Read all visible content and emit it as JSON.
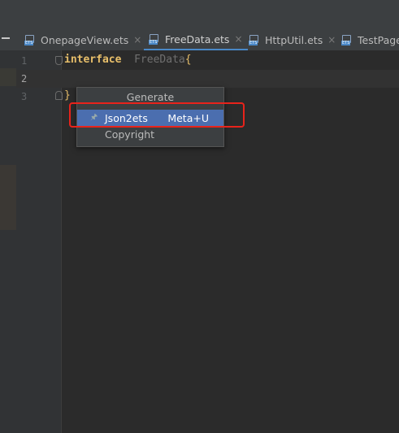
{
  "tabs": [
    {
      "label": "OnepageView.ets",
      "active": false,
      "close": "×",
      "icon": "ets-file-icon"
    },
    {
      "label": "FreeData.ets",
      "active": true,
      "close": "×",
      "icon": "ets-file-icon"
    },
    {
      "label": "HttpUtil.ets",
      "active": false,
      "close": "×",
      "icon": "ets-file-icon"
    },
    {
      "label": "TestPage",
      "active": false,
      "close": "",
      "icon": "ets-file-icon"
    }
  ],
  "gutter": {
    "lines": [
      "1",
      "2",
      "3"
    ]
  },
  "code": {
    "line1_keyword": "interface",
    "line1_name": "FreeData",
    "line1_brace": "{",
    "line3_brace": "}"
  },
  "popup": {
    "title": "Generate",
    "items": [
      {
        "label": "Json2ets",
        "shortcut": "Meta+U",
        "selected": true,
        "icon": "pin-icon"
      },
      {
        "label": "Copyright",
        "shortcut": "",
        "selected": false
      }
    ]
  },
  "colors": {
    "background": "#2b2b2b",
    "selection": "#4b6eaf",
    "highlight_border": "#e8231b",
    "active_tab_underline": "#4a88c7"
  }
}
